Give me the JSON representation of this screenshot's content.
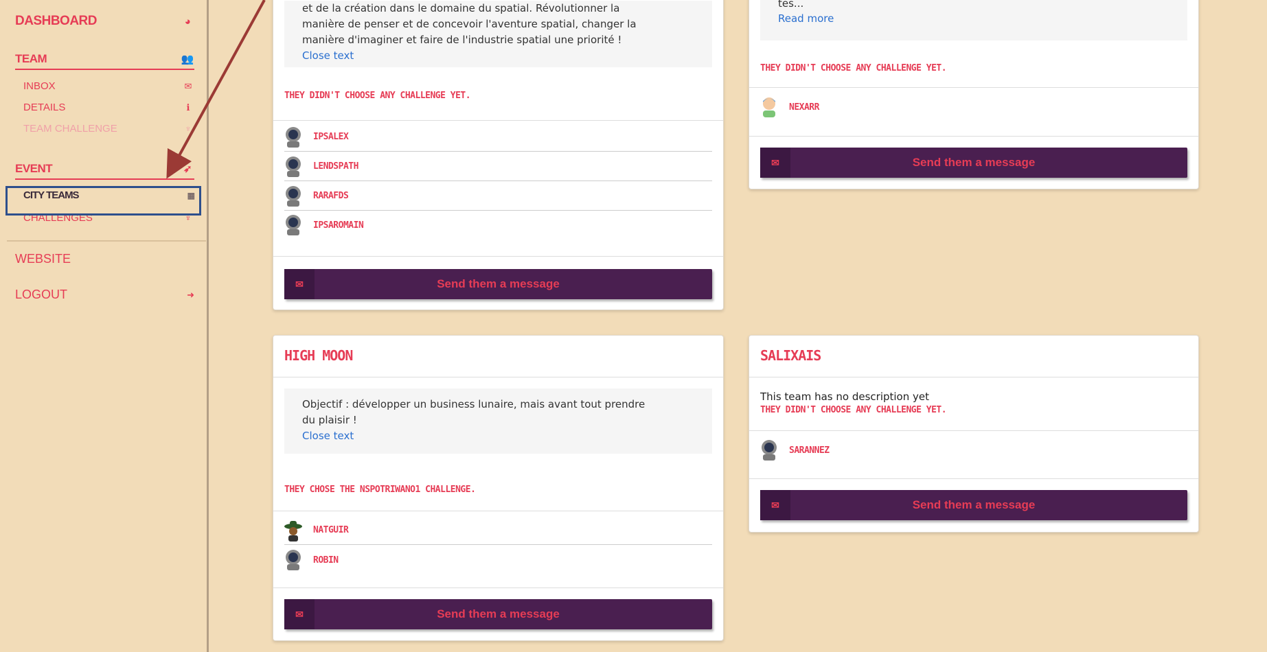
{
  "sidebar": {
    "dashboard": "DASHBOARD",
    "team": "TEAM",
    "inbox": "INBOX",
    "details": "DETAILS",
    "team_challenge": "TEAM CHALLENGE",
    "event": "EVENT",
    "city_teams": "CITY TEAMS",
    "challenges": "CHALLENGES",
    "website": "WEBSITE",
    "logout": "LOGOUT"
  },
  "cards": {
    "top_left": {
      "desc_line1": "et de la création dans le domaine du spatial. Révolutionner la",
      "desc_line2": "manière de penser et de concevoir l'aventure spatial, changer la",
      "desc_line3": "manière d'imaginer et faire de l'industrie spatial une priorité !",
      "desc_link": "Close text",
      "challenge": "THEY DIDN'T CHOOSE ANY CHALLENGE YET.",
      "members": [
        "IPSALEX",
        "LENDSPATH",
        "RARAFDS",
        "IPSAROMAIN"
      ],
      "button": "Send them a message"
    },
    "top_right": {
      "desc_line1": "tes...",
      "desc_link": "Read more",
      "challenge": "THEY DIDN'T CHOOSE ANY CHALLENGE YET.",
      "members": [
        "NEXARR"
      ],
      "button": "Send them a message"
    },
    "high_moon": {
      "title": "HIGH MOON",
      "desc_line1": "Objectif : développer un business lunaire, mais avant tout prendre",
      "desc_line2": "du plaisir !",
      "desc_link": "Close text",
      "challenge": "THEY CHOSE THE NSPOTRIWANO1 CHALLENGE.",
      "members": [
        "NATGUIR",
        "ROBIN"
      ],
      "button": "Send them a message"
    },
    "salixais": {
      "title": "SALIXAIS",
      "no_desc": "This team has no description yet",
      "challenge": "THEY DIDN'T CHOOSE ANY CHALLENGE YET.",
      "members": [
        "SARANNEZ"
      ],
      "button": "Send them a message"
    }
  },
  "colors": {
    "accent": "#e63c55",
    "button_bg": "#4a1f50",
    "page_bg": "#f2dcb8",
    "highlight_box": "#2e4f8c",
    "arrow": "#9b3a35"
  }
}
